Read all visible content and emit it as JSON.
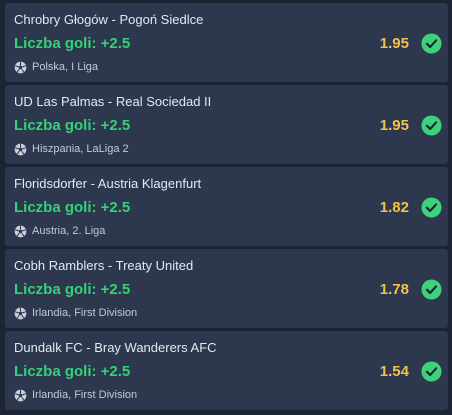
{
  "colors": {
    "background": "#1d2434",
    "card": "#2d374d",
    "market_green": "#34d178",
    "odds_yellow": "#f2c14a",
    "check_green": "#3ed17c"
  },
  "bets": [
    {
      "match": "Chrobry Głogów - Pogoń Siedlce",
      "market": "Liczba goli: +2.5",
      "league": "Polska, I Liga",
      "odds": "1.95",
      "league_icon": "soccer-ball-icon",
      "status_icon": "check-circle-icon"
    },
    {
      "match": "UD Las Palmas - Real Sociedad II",
      "market": "Liczba goli: +2.5",
      "league": "Hiszpania, LaLiga 2",
      "odds": "1.95",
      "league_icon": "soccer-ball-icon",
      "status_icon": "check-circle-icon"
    },
    {
      "match": "Floridsdorfer - Austria Klagenfurt",
      "market": "Liczba goli: +2.5",
      "league": "Austria, 2. Liga",
      "odds": "1.82",
      "league_icon": "soccer-ball-icon",
      "status_icon": "check-circle-icon"
    },
    {
      "match": "Cobh Ramblers - Treaty United",
      "market": "Liczba goli: +2.5",
      "league": "Irlandia, First Division",
      "odds": "1.78",
      "league_icon": "soccer-ball-icon",
      "status_icon": "check-circle-icon"
    },
    {
      "match": "Dundalk FC - Bray Wanderers AFC",
      "market": "Liczba goli: +2.5",
      "league": "Irlandia, First Division",
      "odds": "1.54",
      "league_icon": "soccer-ball-icon",
      "status_icon": "check-circle-icon"
    }
  ]
}
